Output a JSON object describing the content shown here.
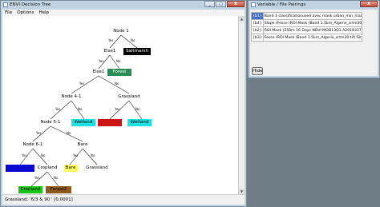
{
  "tree_window": {
    "title": "ENVI Decision Tree",
    "menu": [
      "File",
      "Options",
      "Help"
    ],
    "status": "Grassland: '6/3 & 90 ' [0.0001]",
    "caption_buttons": [
      "_",
      "□",
      "X"
    ]
  },
  "tree": {
    "nodes": [
      {
        "id": "node1",
        "label": "Node 1",
        "bg": "#ffffff"
      },
      {
        "id": "else1",
        "label": "Else1",
        "bg": "#ffffff"
      },
      {
        "id": "saltmarsh",
        "label": "Saltmarsh",
        "bg": "#000000"
      },
      {
        "id": "else1b",
        "label": "Else1",
        "bg": "#ffffff"
      },
      {
        "id": "forest",
        "label": "Forest",
        "bg": "#2e8b57"
      },
      {
        "id": "node41",
        "label": "Node 4-1",
        "bg": "#ffffff"
      },
      {
        "id": "grassland1",
        "label": "Grassland",
        "bg": "#ffffff"
      },
      {
        "id": "node51",
        "label": "Node 5-1",
        "bg": "#ffffff"
      },
      {
        "id": "wetland1",
        "label": "Wetland",
        "bg": "#1ee0e0"
      },
      {
        "id": "red",
        "label": "Red",
        "bg": "#cc1414"
      },
      {
        "id": "wetland2",
        "label": "Wetland",
        "bg": "#1ee0e0"
      },
      {
        "id": "node61",
        "label": "Node 6-1",
        "bg": "#ffffff"
      },
      {
        "id": "bare1",
        "label": "Bare",
        "bg": "#ffffff"
      },
      {
        "id": "blue",
        "label": "Blue",
        "bg": "#0a0ad2"
      },
      {
        "id": "cropland1",
        "label": "Cropland",
        "bg": "#ffffff"
      },
      {
        "id": "bare2",
        "label": "Bare",
        "bg": "#ffff66"
      },
      {
        "id": "grassland2",
        "label": "Grassland",
        "bg": "#ffffff"
      },
      {
        "id": "cropland2",
        "label": "Cropland",
        "bg": "#19c419"
      },
      {
        "id": "forest2",
        "label": "Forest2",
        "bg": "#8b5a1c"
      }
    ],
    "edge_labels": [
      "Yes",
      "No"
    ]
  },
  "pairings_window": {
    "title": "Variable / File Pairings",
    "rows": [
      {
        "var": "{b1}",
        "file": "Band 1 classificationused avec mask urban_min_max"
      },
      {
        "var": "{b4}",
        "file": "Slope (Fesse (ROI Mask (Band 1.5km_Algerie_srtm30:tif):Slo"
      },
      {
        "var": "{b2}",
        "file": "ROI Mask (250m 16 Days NDVI MOD13Q1.A2018337.h17v0"
      },
      {
        "var": "{b3}",
        "file": "Fesse (ROI Mask (Band 1.5km_Algerie_srtm30:tif):Slm_Alge"
      }
    ],
    "hide_label": "Hide"
  }
}
